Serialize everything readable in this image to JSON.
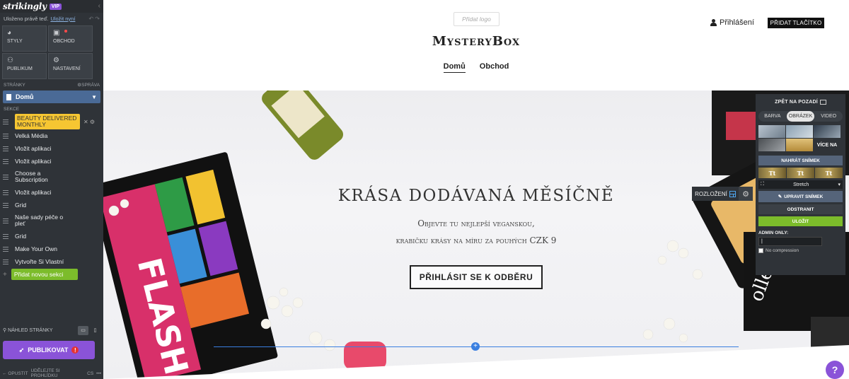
{
  "editor": {
    "logo": "strikingly",
    "badge": "VIP",
    "saved_text": "Uloženo právě teď.",
    "save_now": "Uložit nyní",
    "tiles": [
      {
        "label": "STYLY",
        "icon": "palette-icon"
      },
      {
        "label": "OBCHOD",
        "icon": "cart-icon"
      },
      {
        "label": "PUBLIKUM",
        "icon": "people-icon"
      },
      {
        "label": "NASTAVENÍ",
        "icon": "gear-icon"
      }
    ],
    "pages_label": "STRÁNKY",
    "manage_label": "SPRÁVA",
    "current_page": "Domů",
    "sections_label": "SEKCE",
    "sections": [
      "BEAUTY DELIVERED MONTHLY",
      "Velká Média",
      "Vložit aplikaci",
      "Vložit aplikaci",
      "Choose a Subscription",
      "Vložit aplikaci",
      "Grid",
      "Naše sady péče o pleť",
      "Grid",
      "Make Your Own",
      "Vytvořte Si Vlastní"
    ],
    "add_section": "Přidat novou sekci",
    "preview_label": "NÁHLED STRÁNKY",
    "publish_label": "PUBLIKOVAT",
    "publish_warning": "!",
    "exit_label": "OPUSTIT",
    "feedback_label": "UDĚLEJTE SI PROHLÍDKU",
    "language": "CS"
  },
  "site": {
    "add_logo": "Přidat logo",
    "brand": "MysteryBox",
    "nav": [
      "Domů",
      "Obchod"
    ],
    "login": "Přihlášení",
    "header_button": "PŘIDAT TLAČÍTKO",
    "hero": {
      "title": "KRÁSA DODÁVANÁ MĚSÍČNĚ",
      "subtitle_1": "Objevte tu nejlepší veganskou,",
      "subtitle_2": "krabičku krásy na míru za pouhých CZK 9",
      "cta": "PŘIHLÁSIT SE K ODBĚRU"
    },
    "layout_button": "ROZLOŽENÍ"
  },
  "bg_panel": {
    "title": "ZPĚT NA POZADÍ",
    "tabs": [
      "BARVA",
      "OBRÁZEK",
      "VIDEO"
    ],
    "more": "VÍCE NA",
    "upload": "NAHRÁT SNÍMEK",
    "fit": "Stretch",
    "edit": "UPRAVIT SNÍMEK",
    "remove": "ODSTRANIT",
    "save": "ULOŽIT",
    "admin_only": "ADMIN ONLY:",
    "admin_value": "|",
    "no_compression": "No compression"
  },
  "help": "?",
  "colors": {
    "accent": "#8a53d8",
    "active_section": "#f6c632",
    "add_green": "#7cbc2b",
    "divider_blue": "#3a7fe0"
  }
}
